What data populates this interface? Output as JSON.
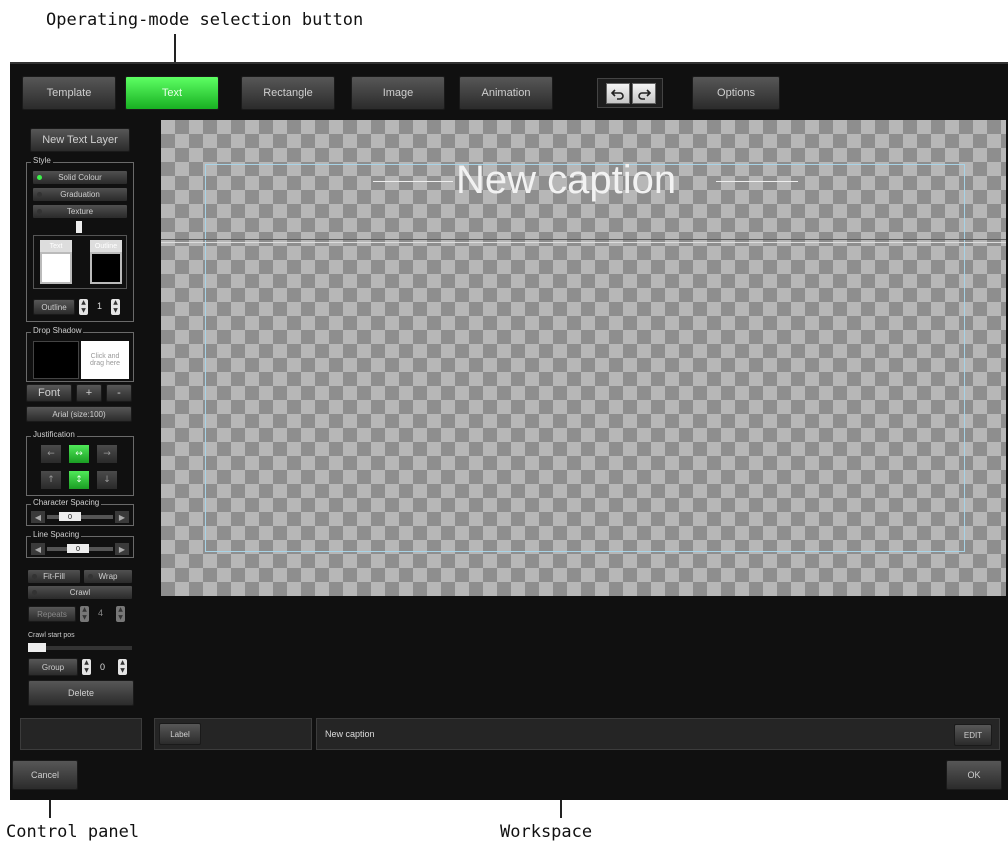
{
  "annotations": {
    "mode_button": "Operating-mode selection button",
    "control_panel": "Control panel",
    "workspace": "Workspace"
  },
  "toolbar": {
    "template": "Template",
    "text": "Text",
    "rectangle": "Rectangle",
    "image": "Image",
    "animation": "Animation",
    "undo_icon": "undo-icon",
    "redo_icon": "redo-icon",
    "options": "Options",
    "active_color": "#2ed43a"
  },
  "panel": {
    "new_text_layer": "New Text Layer",
    "style_label": "Style",
    "style_options": [
      "Solid Colour",
      "Graduation",
      "Texture"
    ],
    "style_selected": "Solid Colour",
    "fill_label": "Text",
    "outline_swatch_label": "Outline",
    "outline_label": "Outline",
    "outline_value": "1",
    "drop_shadow_label": "Drop Shadow",
    "drop_shadow_hint": "Click and drag here",
    "font_label": "Font",
    "font_plus": "+",
    "font_minus": "-",
    "font_name": "Arial (size:100)",
    "justification_label": "Justification",
    "character_spacing_label": "Character Spacing",
    "character_spacing_value": "0",
    "line_spacing_label": "Line Spacing",
    "line_spacing_value": "0",
    "fit_fill": "Fit-Fill",
    "wrap": "Wrap",
    "crawl": "Crawl",
    "repeats_label": "Repeats",
    "repeats_value": "4",
    "crawl_start_label": "Crawl start pos",
    "group_label": "Group",
    "group_value": "0",
    "delete": "Delete"
  },
  "workspace": {
    "caption_text": "New caption"
  },
  "bottom": {
    "label_button": "Label",
    "caption_field": "New caption",
    "edit_button": "EDIT",
    "cancel": "Cancel",
    "ok": "OK"
  }
}
